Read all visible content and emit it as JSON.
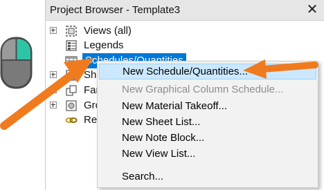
{
  "panel": {
    "title": "Project Browser - Template3",
    "close_glyph": "✕"
  },
  "tree": {
    "items": [
      {
        "label": "Views (all)",
        "icon": "views-icon",
        "expandable": true
      },
      {
        "label": "Legends",
        "icon": "legends-icon",
        "expandable": false
      },
      {
        "label": "Schedules/Quantities",
        "icon": "schedules-icon",
        "expandable": false,
        "selected": true
      },
      {
        "label": "She",
        "icon": "sheets-icon",
        "expandable": true
      },
      {
        "label": "Fam",
        "icon": "families-icon",
        "expandable": true
      },
      {
        "label": "Gro",
        "icon": "groups-icon",
        "expandable": true
      },
      {
        "label": "Re",
        "icon": "revit-links-icon",
        "expandable": false
      }
    ]
  },
  "context_menu": {
    "items": [
      {
        "label": "New Schedule/Quantities...",
        "highlighted": true,
        "disabled": false
      },
      {
        "label": "New Graphical Column Schedule...",
        "highlighted": false,
        "disabled": true
      },
      {
        "label": "New Material Takeoff...",
        "highlighted": false,
        "disabled": false
      },
      {
        "label": "New Sheet List...",
        "highlighted": false,
        "disabled": false
      },
      {
        "label": "New Note Block...",
        "highlighted": false,
        "disabled": false
      },
      {
        "label": "New View List...",
        "highlighted": false,
        "disabled": false
      },
      {
        "label": "Search...",
        "highlighted": false,
        "disabled": false
      }
    ]
  },
  "colors": {
    "accent_selection": "#0078d7",
    "menu_highlight": "#cce8ff",
    "annotation_arrow": "#f07b1e",
    "mouse_button": "#2ec4a6"
  },
  "annotations": {
    "mouse": "mouse-right-click-icon",
    "arrows": [
      "arrow-to-selected-node",
      "arrow-to-menu-item"
    ]
  }
}
